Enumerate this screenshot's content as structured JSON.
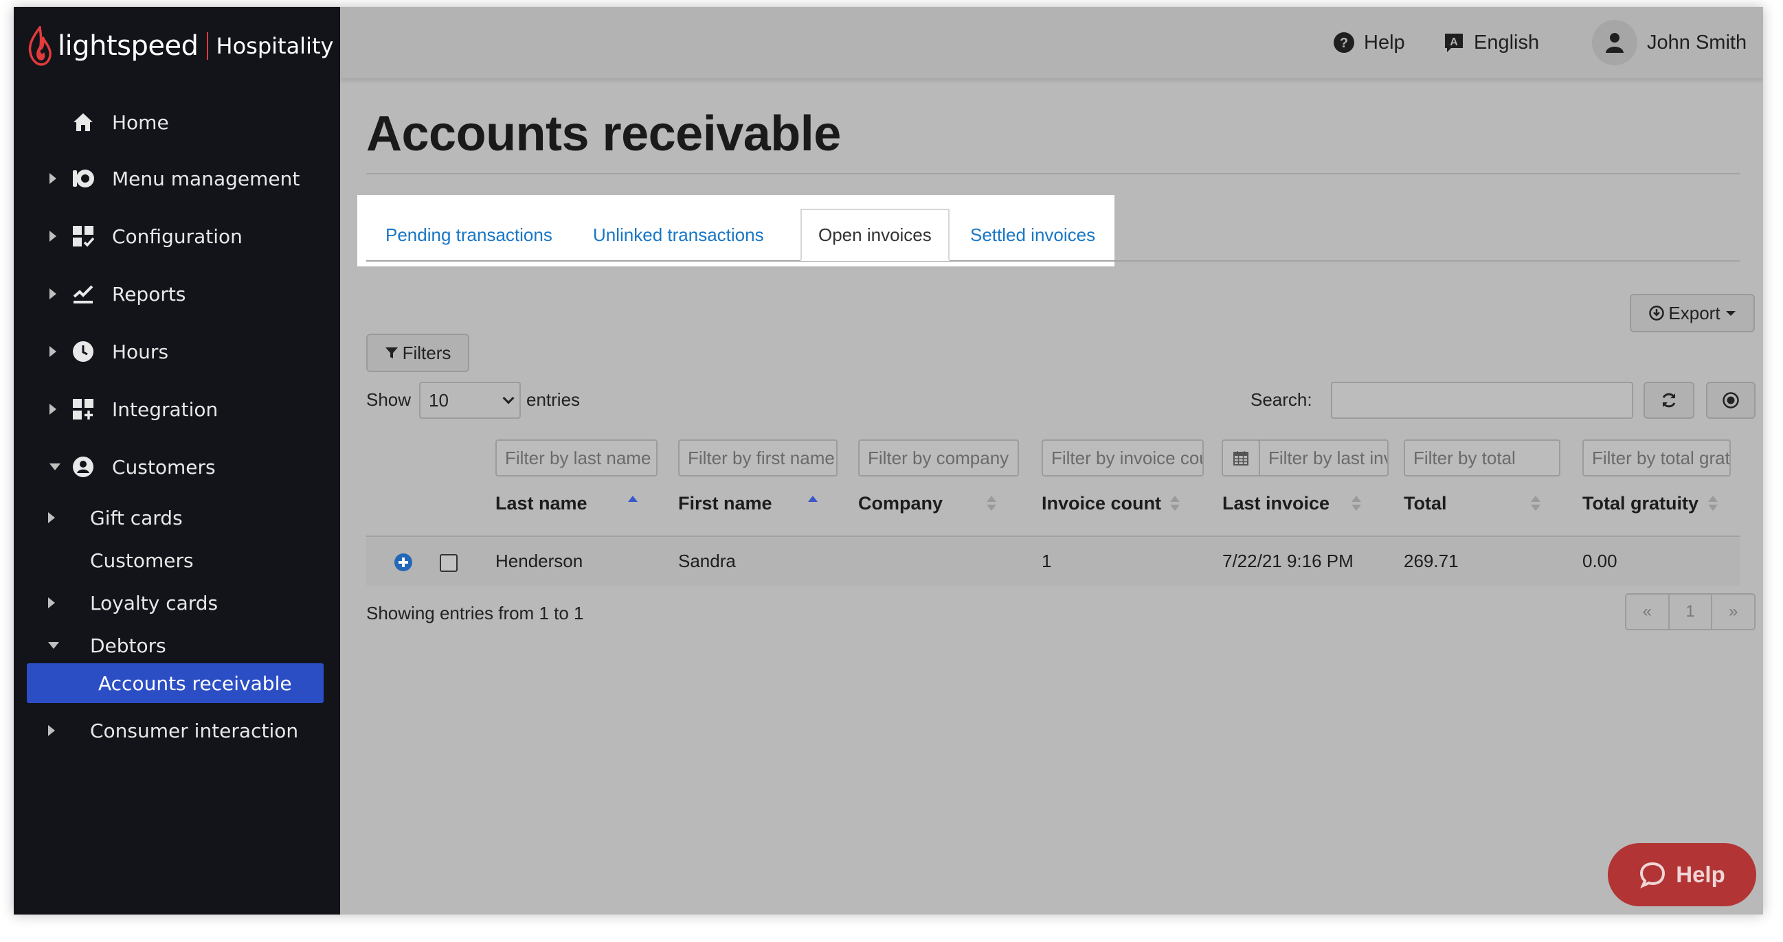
{
  "brand": {
    "name": "lightspeed",
    "product": "Hospitality"
  },
  "colors": {
    "accent": "#2c4ec5",
    "link": "#1877c6",
    "brand_red": "#e23b3b",
    "help_button": "#b23434"
  },
  "sidebar": {
    "items": [
      {
        "label": "Home",
        "icon": "home-icon"
      },
      {
        "label": "Menu management",
        "icon": "menu-management-icon"
      },
      {
        "label": "Configuration",
        "icon": "configuration-icon"
      },
      {
        "label": "Reports",
        "icon": "reports-icon"
      },
      {
        "label": "Hours",
        "icon": "clock-icon"
      },
      {
        "label": "Integration",
        "icon": "integration-icon"
      },
      {
        "label": "Customers",
        "icon": "customer-icon"
      }
    ],
    "subitems": [
      {
        "label": "Gift cards"
      },
      {
        "label": "Customers"
      },
      {
        "label": "Loyalty cards"
      },
      {
        "label": "Debtors"
      },
      {
        "label": "Accounts receivable"
      },
      {
        "label": "Consumer interaction"
      }
    ]
  },
  "header": {
    "help": "Help",
    "language": "English",
    "user": "John Smith"
  },
  "page": {
    "title": "Accounts receivable"
  },
  "tabs": [
    {
      "label": "Pending transactions"
    },
    {
      "label": "Unlinked transactions"
    },
    {
      "label": "Open invoices"
    },
    {
      "label": "Settled invoices"
    }
  ],
  "toolbar": {
    "export": "Export",
    "filters": "Filters",
    "show": "Show",
    "entries_value": "10",
    "entries": "entries",
    "search_label": "Search:"
  },
  "filters": {
    "last_name": "Filter by last name",
    "first_name": "Filter by first name",
    "company": "Filter by company",
    "invoice_count": "Filter by invoice count",
    "last_invoice": "Filter by last invoice",
    "total": "Filter by total",
    "total_gratuity": "Filter by total gratuity"
  },
  "table": {
    "columns": [
      "Last name",
      "First name",
      "Company",
      "Invoice count",
      "Last invoice",
      "Total",
      "Total gratuity"
    ],
    "rows": [
      {
        "last_name": "Henderson",
        "first_name": "Sandra",
        "company": "",
        "invoice_count": "1",
        "last_invoice": "7/22/21 9:16 PM",
        "total": "269.71",
        "total_gratuity": "0.00"
      }
    ]
  },
  "footer": {
    "showing": "Showing entries from 1 to 1"
  },
  "pagination": {
    "prev": "«",
    "current": "1",
    "next": "»"
  },
  "help_button": "Help"
}
